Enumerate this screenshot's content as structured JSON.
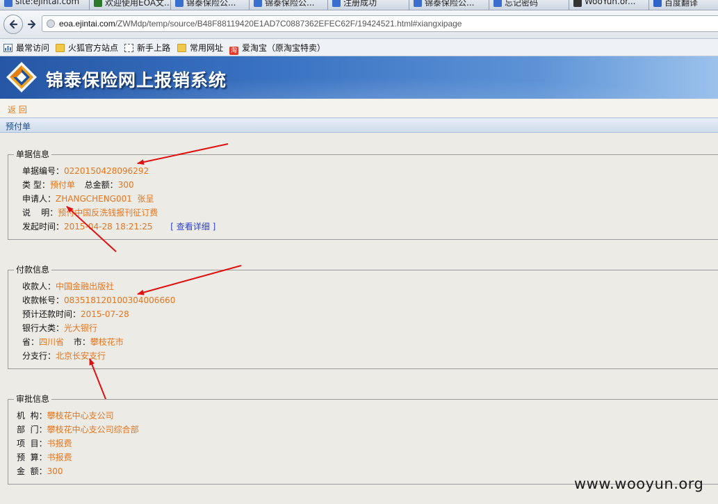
{
  "browser": {
    "tabs": [
      {
        "label": "site:ejintai.com",
        "icon_color": "#3a6fd0"
      },
      {
        "label": "欢迎使用EOA文...",
        "icon_color": "#2d7a2d"
      },
      {
        "label": "锦泰保险公...",
        "icon_color": "#3a6fd0"
      },
      {
        "label": "锦泰保险公...",
        "icon_color": "#3a6fd0"
      },
      {
        "label": "注册成功",
        "icon_color": "#3a6fd0"
      },
      {
        "label": "锦泰保险公...",
        "icon_color": "#3a6fd0"
      },
      {
        "label": "忘记密码",
        "icon_color": "#3a6fd0"
      },
      {
        "label": "WooYun.or...",
        "icon_color": "#333333"
      },
      {
        "label": "百度翻译",
        "icon_color": "#2f64c8"
      }
    ],
    "url_domain": "eoa.ejintai.com",
    "url_path": "/ZWMdp/temp/source/B48F88119420E1AD7C0887362EFEC62F/19424521.html#xiangxipage",
    "bookmarks": [
      {
        "label": "最常访问",
        "icon": "most-visited-icon"
      },
      {
        "label": "火狐官方站点",
        "icon": "folder-icon"
      },
      {
        "label": "新手上路",
        "icon": "dashed-page-icon"
      },
      {
        "label": "常用网址",
        "icon": "folder-icon"
      },
      {
        "label": "爱淘宝（原淘宝特卖）",
        "icon": "taobao-icon"
      }
    ],
    "taobao_icon_text": "淘"
  },
  "app": {
    "title": "锦泰保险网上报销系统",
    "back_label": "返 回",
    "section_title": "预付单"
  },
  "document_info": {
    "legend": "单据信息",
    "doc_no_label": "单据编号：",
    "doc_no": "0220150428096292",
    "type_label": "类  型：",
    "type": "预付单",
    "total_label": "总金额：",
    "total": "300",
    "applicant_label": "申请人：",
    "applicant": "ZHANGCHENG001  张呈",
    "desc_label": "说    明：",
    "desc": "预付中国反洗钱报刊征订费",
    "time_label": "发起时间：",
    "time": "2015-04-28 18:21:25",
    "detail_link": "[ 查看详细 ]"
  },
  "payment_info": {
    "legend": "付款信息",
    "payee_label": "收款人：",
    "payee": "中国金融出版社",
    "account_label": "收款帐号：",
    "account": "083518120100304006660",
    "repay_label": "预计还款时间：",
    "repay": "2015-07-28",
    "bank_label": "银行大类：",
    "bank": "光大银行",
    "province_label": "省：",
    "province": "四川省",
    "city_label": "市：",
    "city": "攀枝花市",
    "branch_label": "分支行：",
    "branch": "北京长安支行"
  },
  "approval_info": {
    "legend": "审批信息",
    "org_label": "机  构：",
    "org": "攀枝花中心支公司",
    "dept_label": "部  门：",
    "dept": "攀枝花中心支公司综合部",
    "item_label": "项  目：",
    "item": "书报费",
    "budget_label": "预  算：",
    "budget": "书报费",
    "amount_label": "金  额：",
    "amount": "300"
  },
  "watermark": "www.wooyun.org",
  "colors": {
    "value": "#e8741c",
    "link": "#2b3fd1",
    "arrow": "#e01010",
    "header": "#2f64b4"
  }
}
